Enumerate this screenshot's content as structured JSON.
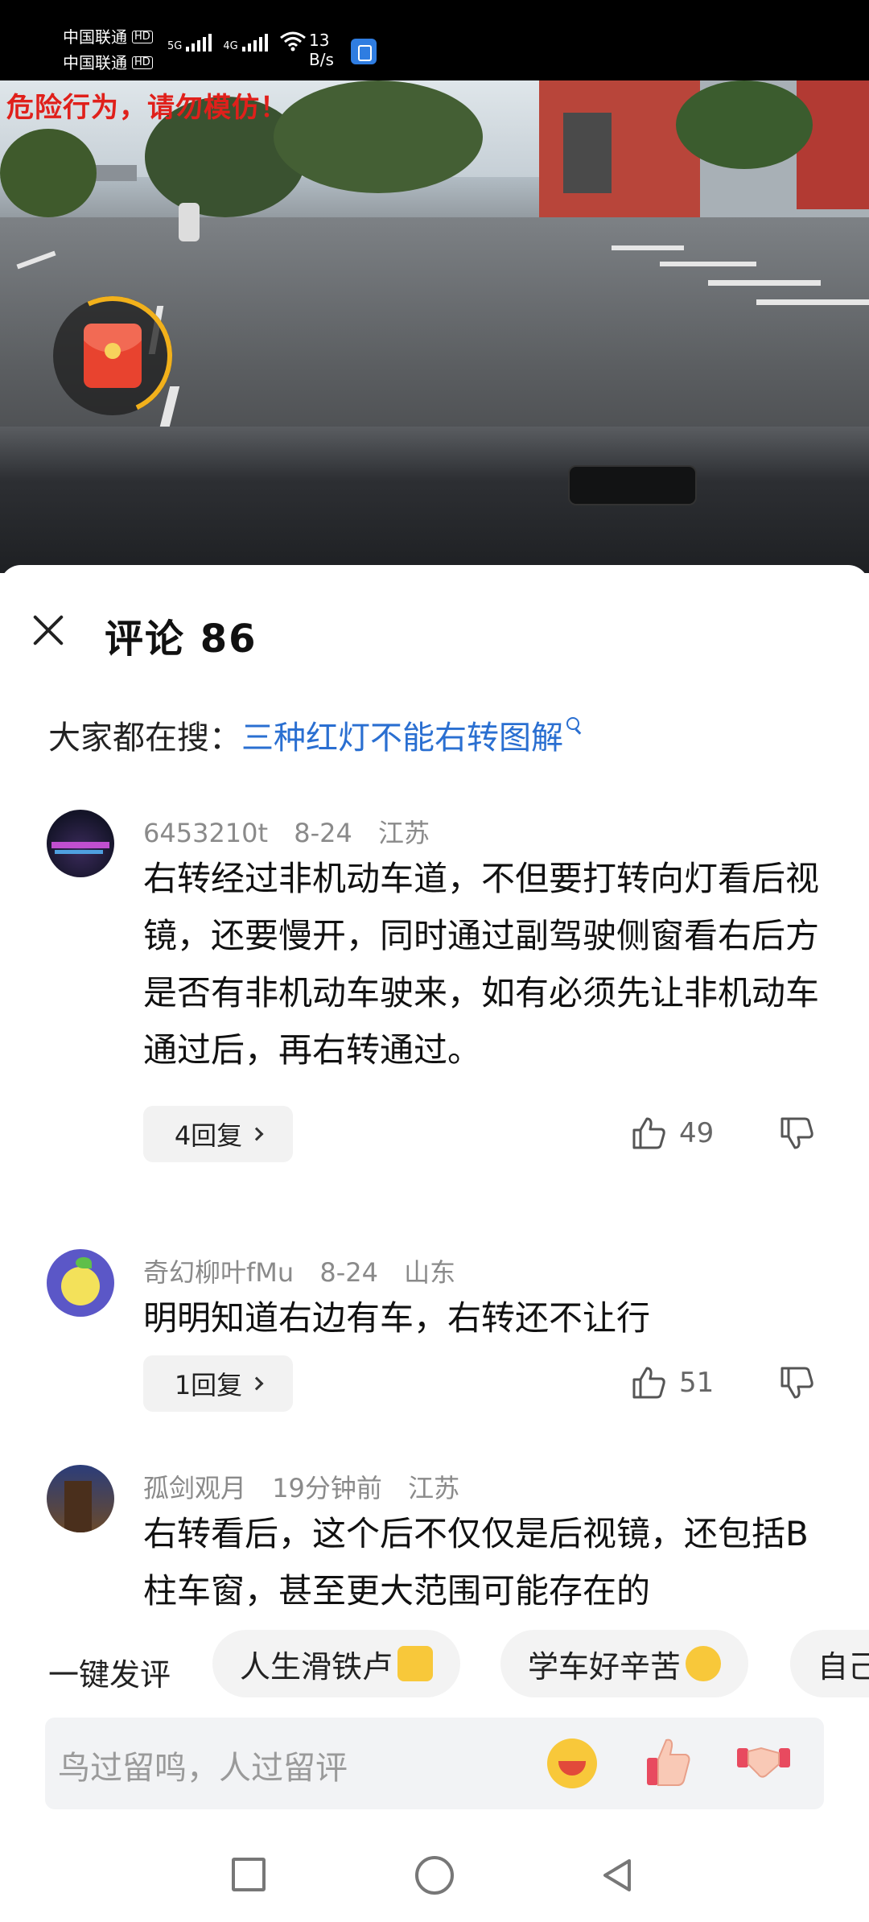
{
  "status": {
    "carrier1": "中国联通",
    "carrier2": "中国联通",
    "hd": "HD",
    "net1": "5G",
    "net2": "4G",
    "speed_value": "13",
    "speed_unit": "B/s"
  },
  "video": {
    "overlay_text": "危险行为，请勿模仿！"
  },
  "header": {
    "title": "评论 86"
  },
  "search": {
    "prefix": "大家都在搜：",
    "link": "三种红灯不能右转图解"
  },
  "comments": [
    {
      "user": "6453210t",
      "date": "8-24",
      "region": "江苏",
      "text": "右转经过非机动车道，不但要打转向灯看后视镜，还要慢开，同时通过副驾驶侧窗看右后方是否有非机动车驶来，如有必须先让非机动车通过后，再右转通过。",
      "replies": "4回复",
      "likes": "49"
    },
    {
      "user": "奇幻柳叶fMu",
      "date": "8-24",
      "region": "山东",
      "text": "明明知道右边有车，右转还不让行",
      "replies": "1回复",
      "likes": "51"
    },
    {
      "user": "孤剑观月",
      "date": "19分钟前",
      "region": "江苏",
      "text": "右转看后，这个后不仅仅是后视镜，还包括B柱车窗，甚至更大范围可能存在的"
    }
  ],
  "quick": {
    "label": "一键发评",
    "chips": [
      "人生滑铁卢",
      "学车好辛苦",
      "自己"
    ]
  },
  "input": {
    "placeholder": "鸟过留鸣，人过留评"
  },
  "colors": {
    "link": "#2a6fd1",
    "warning": "#e0201b",
    "accent_ring": "#f2b11b"
  }
}
